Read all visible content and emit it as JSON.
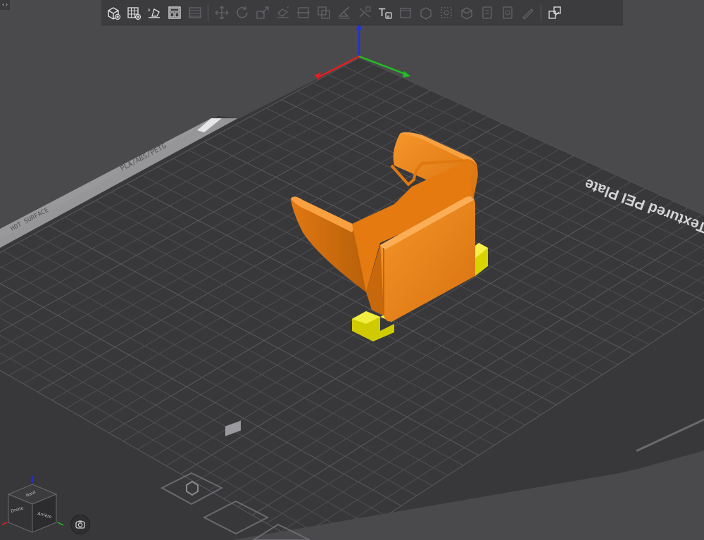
{
  "bed": {
    "label_main": "Textured PEI Plate",
    "label_filament": "PLA/ABS/PETG",
    "label_side": "HOT SURFACE"
  },
  "view_cube": {
    "face_top": "Haut",
    "face_right": "Arrière",
    "face_left": "Droite"
  },
  "toolbar": {
    "buttons": [
      {
        "icon": "add-object-icon",
        "enabled": true
      },
      {
        "icon": "add-plate-icon",
        "enabled": true
      },
      {
        "icon": "auto-orient-icon",
        "enabled": true
      },
      {
        "icon": "arrange-icon",
        "enabled": true
      },
      {
        "icon": "split-plates-icon",
        "enabled": false
      },
      {
        "icon": "move-icon",
        "enabled": false
      },
      {
        "icon": "rotate-icon",
        "enabled": false
      },
      {
        "icon": "scale-icon",
        "enabled": false
      },
      {
        "icon": "lay-on-face-icon",
        "enabled": false
      },
      {
        "icon": "cut-icon",
        "enabled": false
      },
      {
        "icon": "mesh-boolean-icon",
        "enabled": false
      },
      {
        "icon": "support-paint-icon",
        "enabled": false
      },
      {
        "icon": "seam-paint-icon",
        "enabled": false
      },
      {
        "icon": "text-icon",
        "enabled": true
      },
      {
        "icon": "measure-icon",
        "enabled": false
      },
      {
        "icon": "assembly-icon",
        "enabled": false
      },
      {
        "icon": "variable-layer-icon",
        "enabled": false
      },
      {
        "icon": "emboss-icon",
        "enabled": false
      },
      {
        "icon": "svg-icon",
        "enabled": false
      },
      {
        "icon": "brim-ears-icon",
        "enabled": false
      },
      {
        "icon": "paint-icon",
        "enabled": false
      },
      {
        "icon": "view-explode-icon",
        "enabled": true
      }
    ]
  },
  "colors": {
    "background": "#4a4a4d",
    "bed": "#38383b",
    "grid": "#4f4f53",
    "object": "#f28a1e",
    "object_shade": "#c8680c",
    "support": "#e4e000",
    "axis_x": "#e02020",
    "axis_y": "#20c020",
    "axis_z": "#2030e0"
  }
}
